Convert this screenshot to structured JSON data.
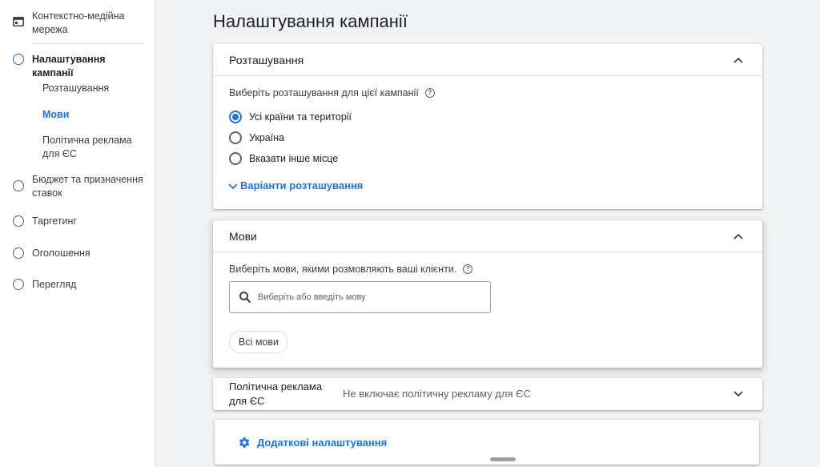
{
  "sidebar": {
    "top_item": {
      "label": "Контекстно-медійна мережа",
      "icon": "display-network-icon"
    },
    "steps": [
      {
        "label": "Налаштування кампанії",
        "active": true
      },
      {
        "label": "Бюджет та призначення ставок",
        "active": false
      },
      {
        "label": "Таргетинг",
        "active": false
      },
      {
        "label": "Оголошення",
        "active": false
      },
      {
        "label": "Перегляд",
        "active": false
      }
    ],
    "substeps": [
      {
        "label": "Розташування",
        "active": false
      },
      {
        "label": "Мови",
        "active": true
      },
      {
        "label": "Політична реклама для ЄС",
        "active": false
      }
    ]
  },
  "main": {
    "title": "Налаштування кампанії",
    "location_card": {
      "title": "Розташування",
      "hint": "Виберіть розташування для цієї кампанії",
      "options": [
        {
          "label": "Усі країни та території",
          "checked": true
        },
        {
          "label": "Україна",
          "checked": false
        },
        {
          "label": "Вказати інше місце",
          "checked": false
        }
      ],
      "more_link": "Варіанти розташування"
    },
    "languages_card": {
      "title": "Мови",
      "hint": "Виберіть мови, якими розмовляють ваші клієнти.",
      "search_placeholder": "Виберіть або введіть мову",
      "chip": "Всі мови"
    },
    "eu_political_card": {
      "title": "Політична реклама для ЄС",
      "summary": "Не включає політичну рекламу для ЄС"
    },
    "additional_settings": {
      "label": "Додаткові налаштування",
      "icon": "gear-icon"
    }
  },
  "colors": {
    "accent": "#1a73e8",
    "text": "#202124",
    "muted": "#5f6368",
    "background": "#f1f3f4"
  }
}
